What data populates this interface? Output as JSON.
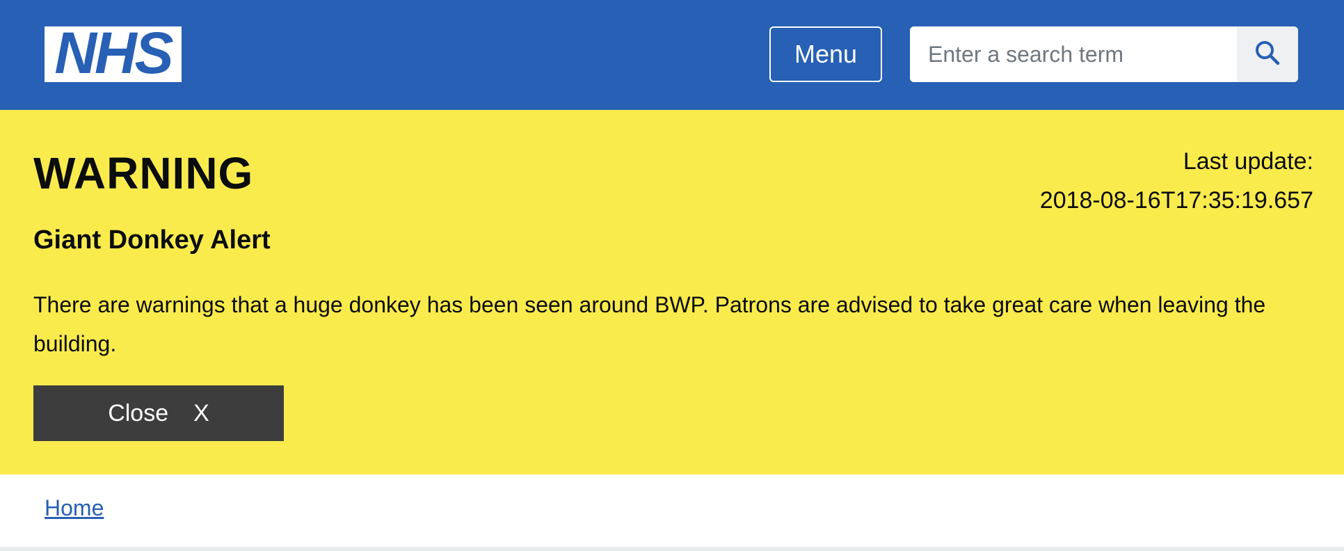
{
  "header": {
    "logo_text": "NHS",
    "menu_label": "Menu",
    "search": {
      "placeholder": "Enter a search term",
      "value": "",
      "icon": "search-icon"
    }
  },
  "alert": {
    "title": "WARNING",
    "last_update_label": "Last update:",
    "last_update_value": "2018-08-16T17:35:19.657",
    "subtitle": "Giant Donkey Alert",
    "body": "There are warnings that a huge donkey has been seen around BWP. Patrons are advised to take great care when leaving the building.",
    "close_label": "Close",
    "close_icon_text": "X"
  },
  "breadcrumb": {
    "home_label": "Home"
  },
  "colors": {
    "brand_blue": "#2760b4",
    "alert_yellow": "#faeb4d",
    "button_dark": "#3d3d3d"
  }
}
